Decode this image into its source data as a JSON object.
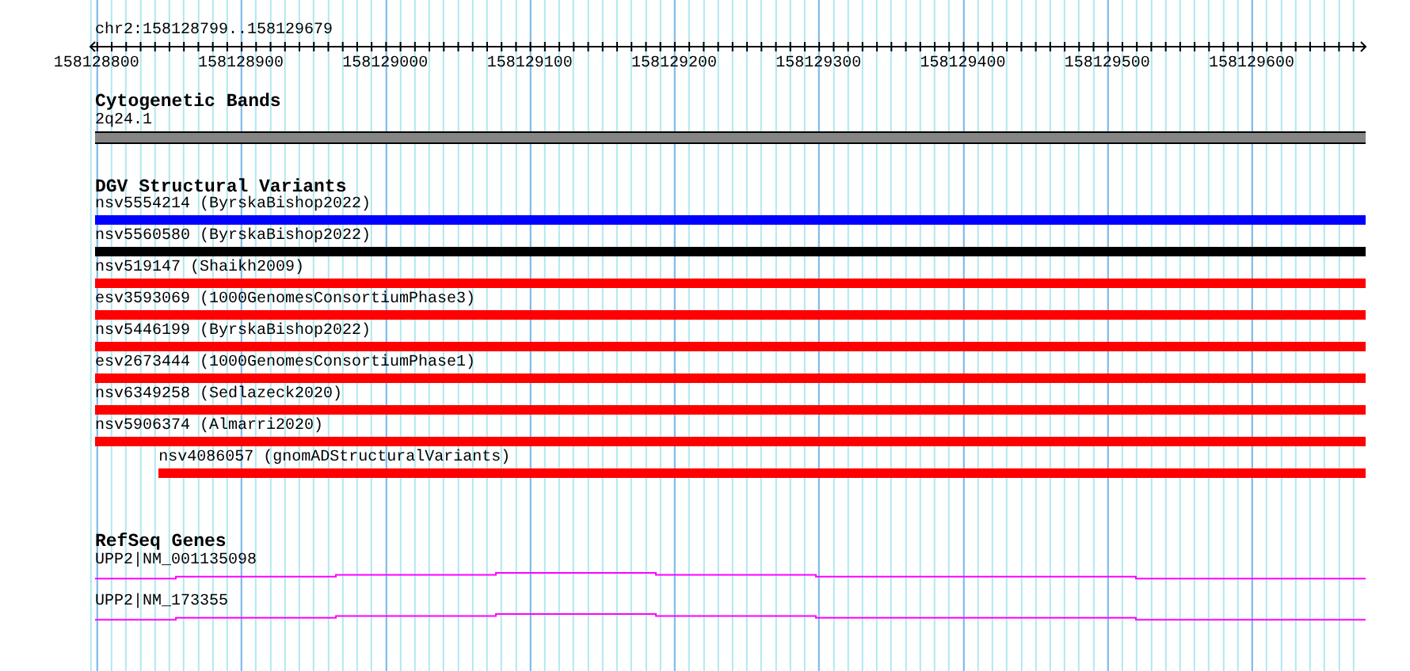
{
  "region": {
    "title": "chr2:158128799..158129679",
    "ticks": [
      "158128800",
      "158128900",
      "158129000",
      "158129100",
      "158129200",
      "158129300",
      "158129400",
      "158129500",
      "158129600"
    ]
  },
  "cytogenetic_bands": {
    "heading": "Cytogenetic Bands",
    "bands": [
      {
        "label": "2q24.1"
      }
    ]
  },
  "dgv_structural_variants": {
    "heading": "DGV Structural Variants",
    "variants": [
      {
        "label": "nsv5554214 (ByrskaBishop2022)",
        "color": "#0000ff",
        "level": 1
      },
      {
        "label": "nsv5560580 (ByrskaBishop2022)",
        "color": "#000000",
        "level": 1
      },
      {
        "label": "nsv519147 (Shaikh2009)",
        "color": "#ff0000",
        "level": 1
      },
      {
        "label": "esv3593069 (1000GenomesConsortiumPhase3)",
        "color": "#ff0000",
        "level": 1
      },
      {
        "label": "nsv5446199 (ByrskaBishop2022)",
        "color": "#ff0000",
        "level": 1
      },
      {
        "label": "esv2673444 (1000GenomesConsortiumPhase1)",
        "color": "#ff0000",
        "level": 1
      },
      {
        "label": "nsv6349258 (Sedlazeck2020)",
        "color": "#ff0000",
        "level": 1
      },
      {
        "label": "nsv5906374 (Almarri2020)",
        "color": "#ff0000",
        "level": 1
      },
      {
        "label": "nsv4086057 (gnomADStructuralVariants)",
        "color": "#ff0000",
        "level": 0.95
      }
    ]
  },
  "refseq_genes": {
    "heading": "RefSeq Genes",
    "transcripts": [
      {
        "label": "UPP2|NM_001135098"
      },
      {
        "label": "UPP2|NM_173355"
      }
    ]
  }
}
